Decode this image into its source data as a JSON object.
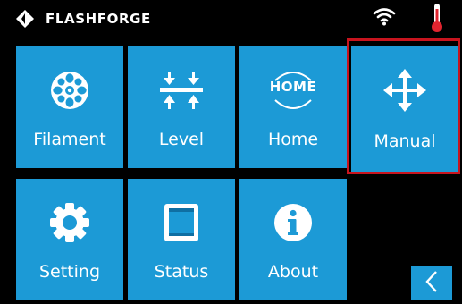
{
  "status_bar": {
    "brand": "FLASHFORGE",
    "logo_icon": "flashforge-diamond-logo",
    "wifi_icon": "wifi-icon",
    "thermometer_icon": "thermometer-icon",
    "thermometer_color": "#e0242f"
  },
  "menu": {
    "tiles": [
      {
        "label": "Filament",
        "icon": "filament-spool-icon"
      },
      {
        "label": "Level",
        "icon": "level-arrows-icon"
      },
      {
        "label": "Home",
        "icon": "home-badge-icon",
        "icon_text": "HOME"
      },
      {
        "label": "Manual",
        "icon": "move-arrows-icon",
        "selected": true
      },
      {
        "label": "Setting",
        "icon": "gear-icon"
      },
      {
        "label": "Status",
        "icon": "printer-status-icon"
      },
      {
        "label": "About",
        "icon": "info-icon"
      }
    ]
  },
  "nav": {
    "back_icon": "chevron-left-icon"
  },
  "colors": {
    "background": "#000000",
    "tile": "#1c9ad6",
    "text": "#ffffff",
    "selection_outline": "#c8141e"
  }
}
